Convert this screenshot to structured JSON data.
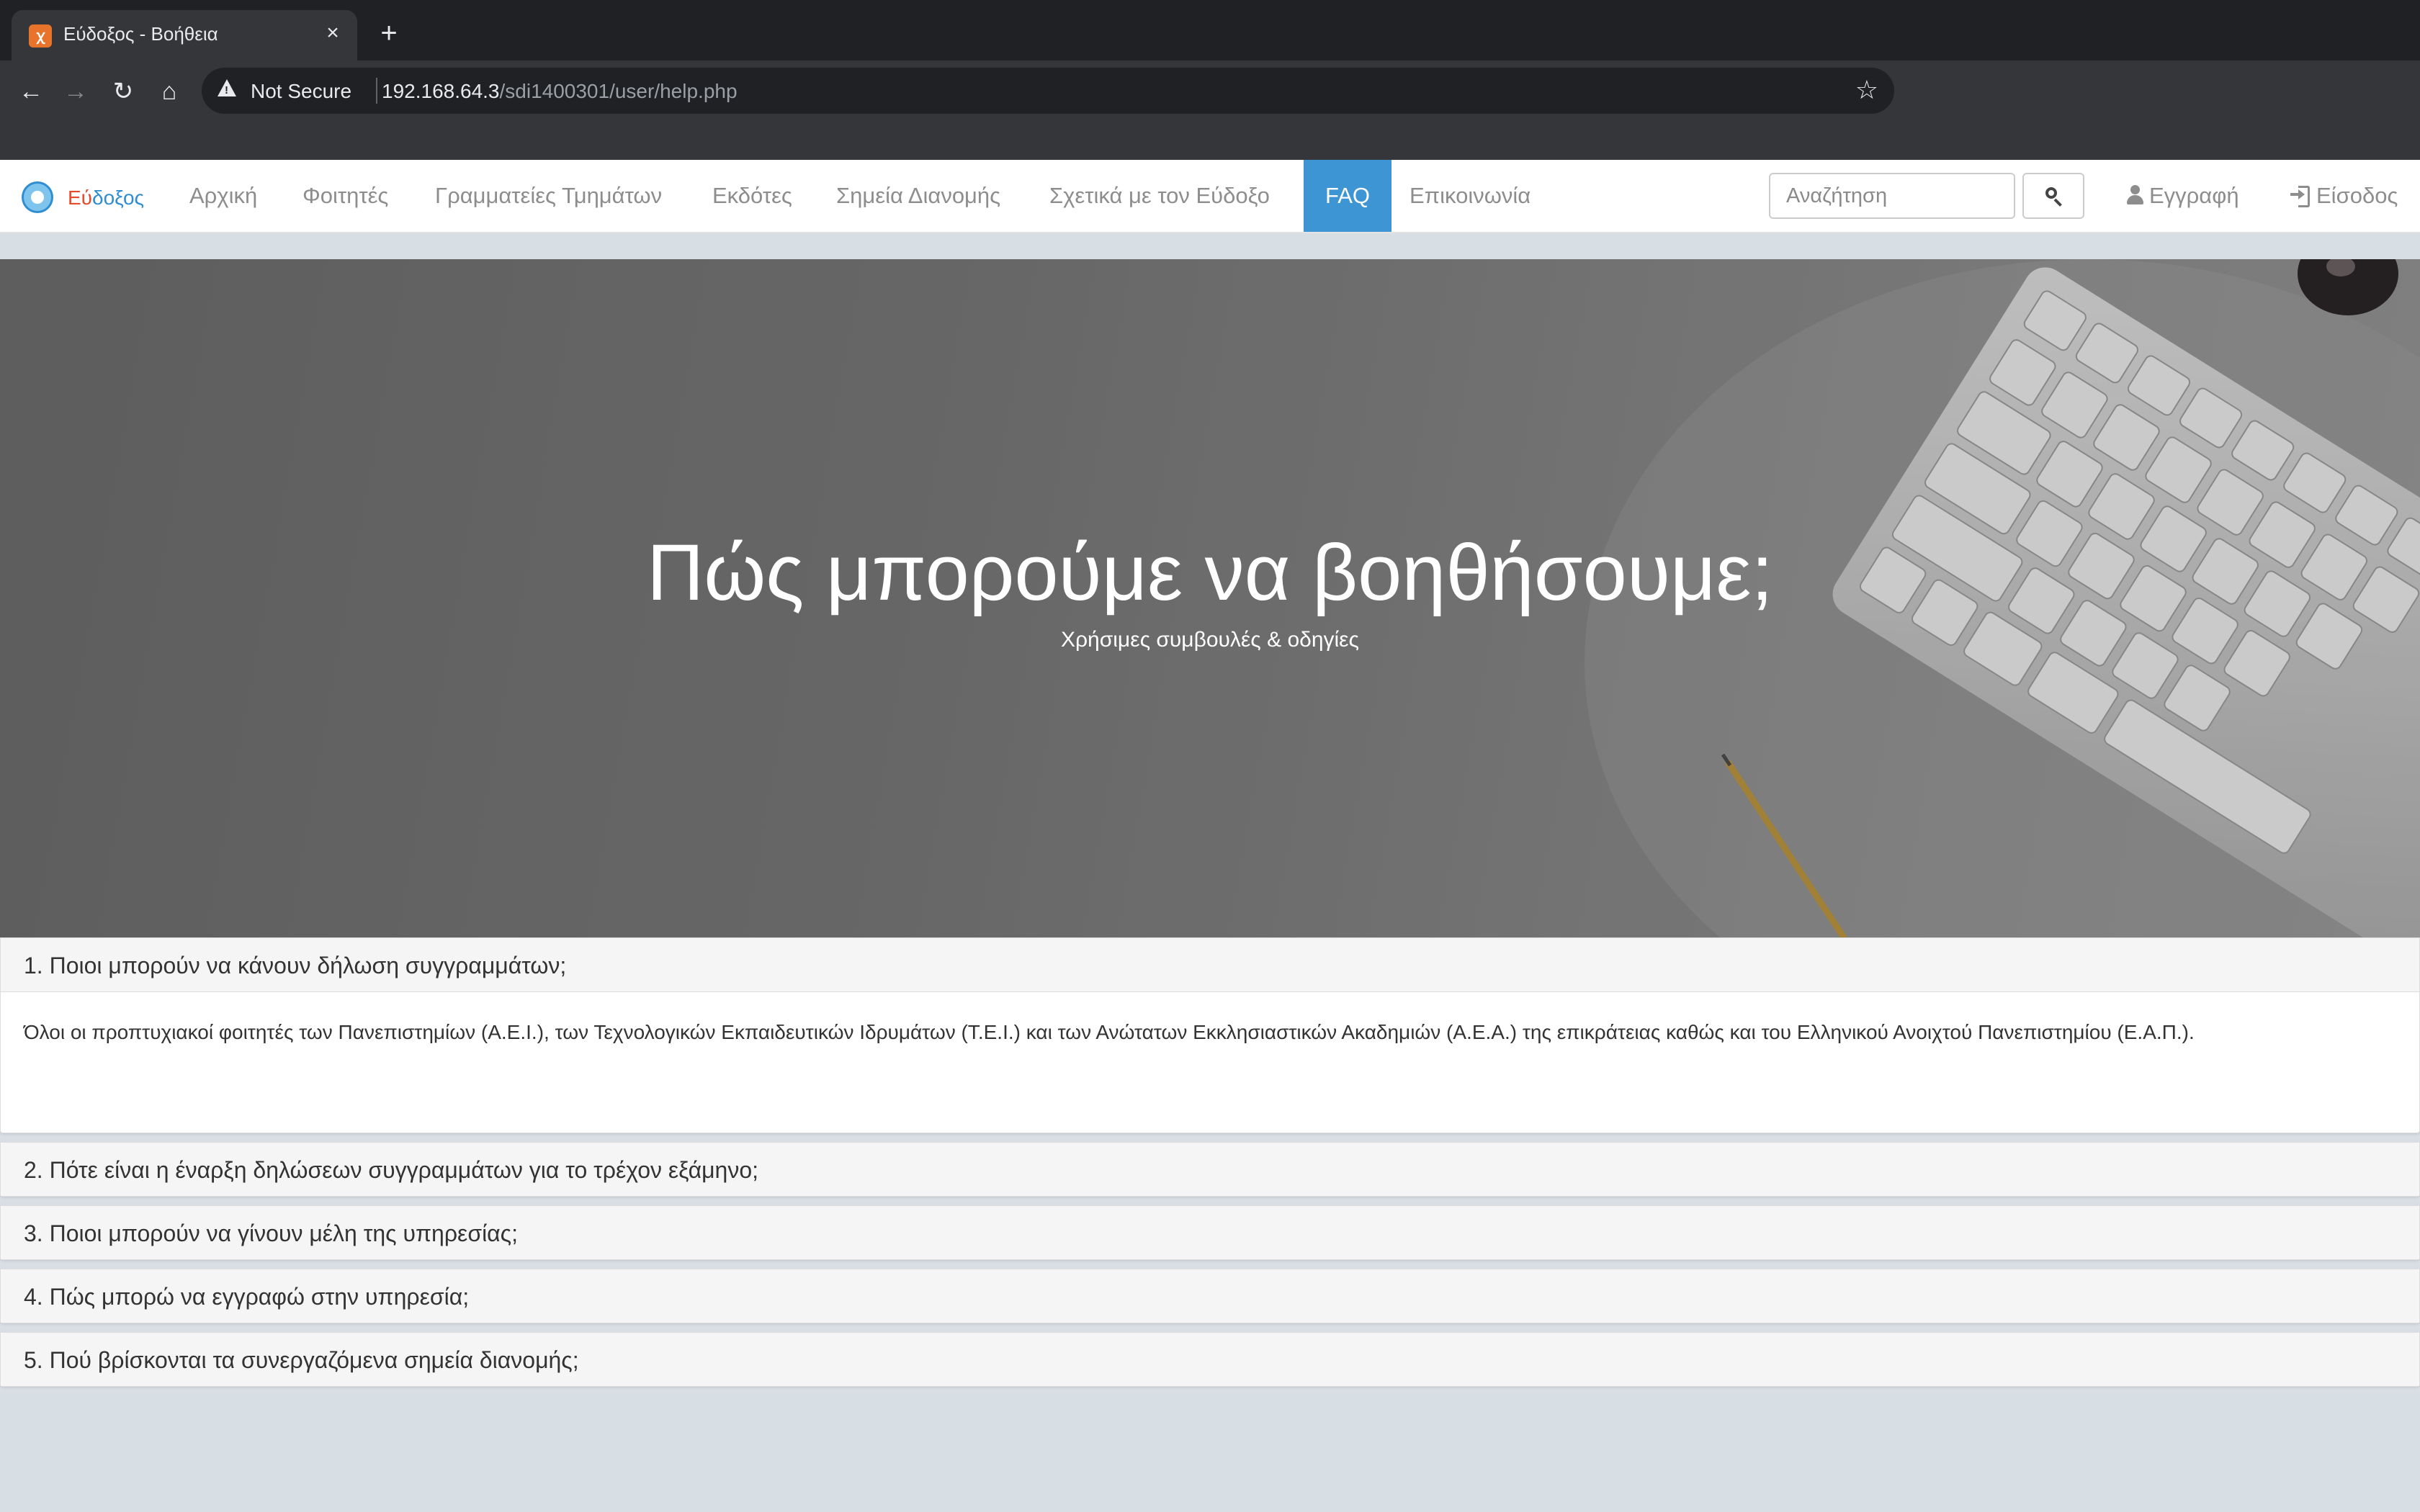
{
  "browser": {
    "tab_title": "Εύδοξος - Βοήθεια",
    "tab_favicon": "xampp-favicon",
    "security_label": "Not Secure",
    "url_host": "192.168.64.3",
    "url_path": "/sdi1400301/user/help.php"
  },
  "site": {
    "brand_part1": "Εύ",
    "brand_part2": "δοξος",
    "nav": [
      "Αρχική",
      "Φοιτητές",
      "Γραμματείες Τμημάτων",
      "Εκδότες",
      "Σημεία Διανομής",
      "Σχετικά με τον Εύδοξο",
      "FAQ",
      "Επικοινωνία"
    ],
    "active_nav": "FAQ",
    "search_placeholder": "Αναζήτηση",
    "register_label": "Εγγραφή",
    "login_label": "Είσοδος",
    "accent_color": "#3d95d4"
  },
  "hero": {
    "title": "Πώς μπορούμε να βοηθήσουμε;",
    "subtitle": "Χρήσιμες συμβουλές & οδηγίες"
  },
  "faq": [
    {
      "question": "1. Ποιοι μπορούν να κάνουν δήλωση συγγραμμάτων;",
      "answer": "Όλοι οι προπτυχιακοί φοιτητές των Πανεπιστημίων (Α.Ε.Ι.), των Τεχνολογικών Εκπαιδευτικών Ιδρυμάτων (Τ.Ε.Ι.) και των Ανώτατων Εκκλησιαστικών Ακαδημιών (Α.Ε.Α.) της επικράτειας καθώς και του Ελληνικού Ανοιχτού Πανεπιστημίου (Ε.Α.Π.).",
      "expanded": true
    },
    {
      "question": "2. Πότε είναι η έναρξη δηλώσεων συγγραμμάτων για το τρέχον εξάμηνο;",
      "expanded": false
    },
    {
      "question": "3. Ποιοι μπορούν να γίνουν μέλη της υπηρεσίας;",
      "expanded": false
    },
    {
      "question": "4. Πώς μπορώ να εγγραφώ στην υπηρεσία;",
      "expanded": false
    },
    {
      "question": "5. Πού βρίσκονται τα συνεργαζόμενα σημεία διανομής;",
      "expanded": false
    }
  ]
}
